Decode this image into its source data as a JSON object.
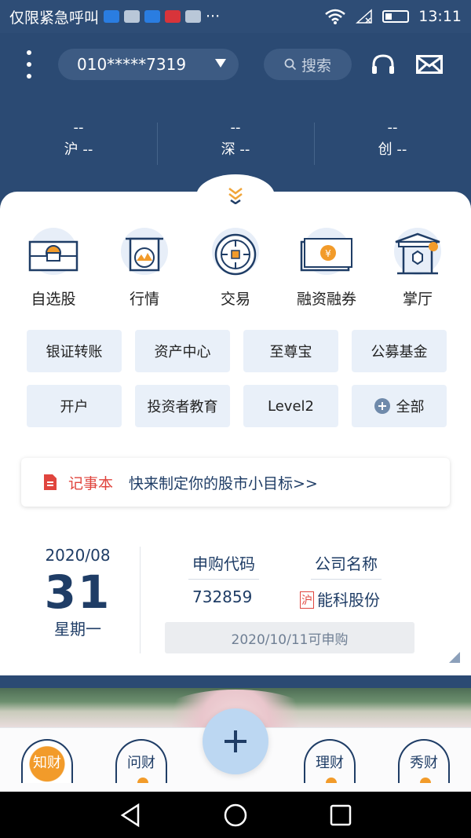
{
  "status_bar": {
    "carrier_text": "仅限紧急呼叫",
    "time": "13:11",
    "more_glyph": "···"
  },
  "header": {
    "account_number": "010*****7319",
    "search_label": "搜索"
  },
  "indices": [
    {
      "value": "--",
      "name": "沪 --"
    },
    {
      "value": "--",
      "name": "深 --"
    },
    {
      "value": "--",
      "name": "创 --"
    }
  ],
  "main_menu": [
    {
      "label": "自选股",
      "icon": "watchlist-icon"
    },
    {
      "label": "行情",
      "icon": "market-icon"
    },
    {
      "label": "交易",
      "icon": "trade-icon"
    },
    {
      "label": "融资融券",
      "icon": "margin-icon"
    },
    {
      "label": "掌厅",
      "icon": "hall-icon"
    }
  ],
  "quick_links": [
    {
      "label": "银证转账"
    },
    {
      "label": "资产中心"
    },
    {
      "label": "至尊宝"
    },
    {
      "label": "公募基金"
    },
    {
      "label": "开户"
    },
    {
      "label": "投资者教育"
    },
    {
      "label": "Level2"
    },
    {
      "label": "全部"
    }
  ],
  "notebook": {
    "title": "记事本",
    "text": "快来制定你的股市小目标>>"
  },
  "ipo": {
    "year_month": "2020/08",
    "day": "31",
    "weekday": "星期一",
    "code_header": "申购代码",
    "name_header": "公司名称",
    "code": "732859",
    "market_tag": "沪",
    "company": "能科股份",
    "apply_text": "2020/10/11可申购"
  },
  "tabbar": {
    "tabs": [
      {
        "label": "知财",
        "active": true
      },
      {
        "label": "问财",
        "active": false
      },
      {
        "label": "理财",
        "active": false
      },
      {
        "label": "秀财",
        "active": false
      }
    ]
  },
  "colors": {
    "header_bg": "#2b4a73",
    "accent_text": "#1f3d66",
    "alert_red": "#e0453e",
    "tab_orange": "#f29b2a",
    "link_bg": "#e9f0f9"
  }
}
